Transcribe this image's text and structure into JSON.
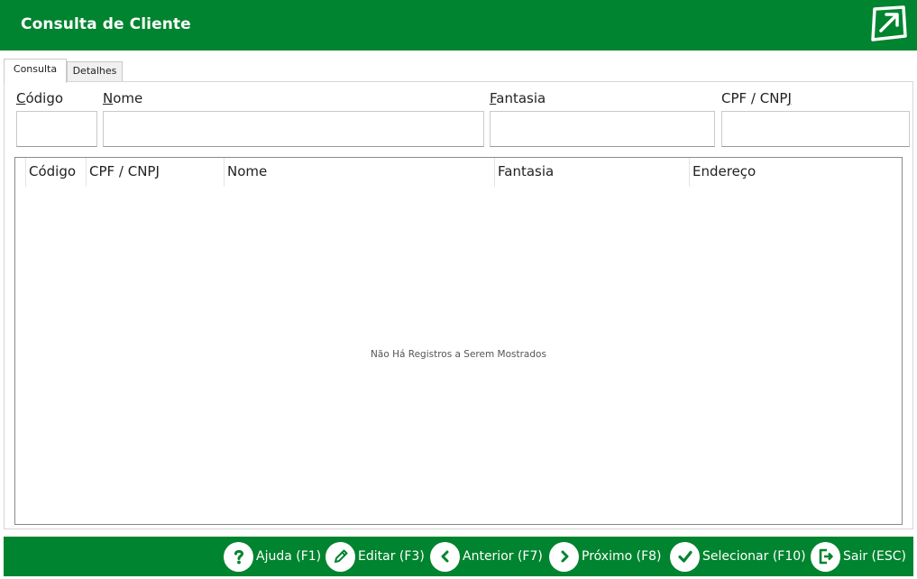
{
  "window": {
    "title": "Consulta de Cliente"
  },
  "tabs": [
    {
      "label": "Consulta",
      "active": true
    },
    {
      "label": "Detalhes",
      "active": false
    }
  ],
  "filters": {
    "codigo": {
      "label_mnemonic": "C",
      "label_rest": "ódigo",
      "value": "",
      "placeholder": ""
    },
    "nome": {
      "label_mnemonic": "N",
      "label_rest": "ome",
      "value": "",
      "placeholder": ""
    },
    "fantasia": {
      "label_mnemonic": "F",
      "label_rest": "antasia",
      "value": "",
      "placeholder": ""
    },
    "cpf_cnpj": {
      "label_prefix": "CPF / CNP",
      "label_mnemonic": "J",
      "value": "",
      "placeholder": ""
    }
  },
  "grid": {
    "columns": [
      "Código",
      "CPF / CNPJ",
      "Nome",
      "Fantasia",
      "Endereço"
    ],
    "rows": [],
    "empty_message": "Não Há Registros a Serem Mostrados"
  },
  "actions": [
    {
      "id": "ajuda",
      "label": "Ajuda (F1)",
      "icon": "question-icon"
    },
    {
      "id": "editar",
      "label": "Editar (F3)",
      "icon": "pencil-icon"
    },
    {
      "id": "anterior",
      "label": "Anterior (F7)",
      "icon": "chevron-left-icon"
    },
    {
      "id": "proximo",
      "label": "Próximo (F8)",
      "icon": "chevron-right-icon"
    },
    {
      "id": "selecionar",
      "label": "Selecionar (F10)",
      "icon": "checkmark-icon"
    },
    {
      "id": "sair",
      "label": "Sair (ESC)",
      "icon": "exit-icon"
    }
  ],
  "colors": {
    "brand_green": "#00842f",
    "white": "#ffffff"
  }
}
